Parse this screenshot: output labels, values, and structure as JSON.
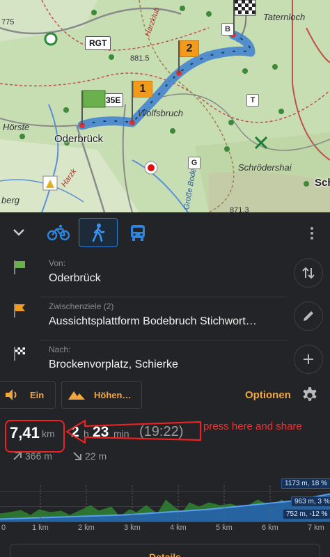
{
  "map": {
    "labels": {
      "town_oderbrueck": "Oderbrück",
      "place_wolfsbruch": "Wolfsbruch",
      "place_schroedershai": "Schrödershai",
      "place_taternloch": "Taternloch",
      "place_hoerste": "Hörste",
      "place_berg": "berg",
      "place_sch": "Sch",
      "road_harzklub": "Harzklub",
      "road_harzk": "Harzk",
      "road_grosse_bode": "Große Bode",
      "elev_881": "881.5",
      "elev_871": "871.3",
      "elev_775": "775"
    },
    "road_tags": {
      "rgt": "RGT",
      "b_mark": "B",
      "b35e": "35E",
      "g_mark": "G",
      "t_mark": "T"
    },
    "intermediate_flags": [
      "1",
      "2"
    ],
    "colors": {
      "route": "#3d7fd0",
      "background": "#c9dfb6",
      "flag_orange": "#f29a1c",
      "flag_green": "#6ab04c"
    }
  },
  "panel": {
    "modes": [
      {
        "name": "bicycle",
        "active": false
      },
      {
        "name": "pedestrian",
        "active": true
      },
      {
        "name": "bus",
        "active": false
      }
    ],
    "route": {
      "from_caption": "Von:",
      "from_value": "Oderbrück",
      "via_caption": "Zwischenziele (2)",
      "via_value": "Aussichtsplattform Bodebruch Stichwort…",
      "to_caption": "Nach:",
      "to_value": "Brockenvorplatz, Schierke"
    },
    "options": {
      "sound_label": "Ein",
      "elevation_label": "Höhen…",
      "options_label": "Optionen"
    },
    "stats": {
      "distance_value": "7,41",
      "distance_unit": "km",
      "hours_value": "2",
      "hours_unit": "h",
      "minutes_value": "23",
      "minutes_unit": "min",
      "arrival_time": "(19:22)",
      "ascent": "366 m",
      "descent": "22 m"
    },
    "annotation": {
      "text": "press here and share"
    },
    "chart": {
      "badges": [
        "1173 m, 18 %",
        "963 m, 3 %",
        "752 m, -12 %"
      ],
      "km_labels": [
        "0",
        "1 km",
        "2 km",
        "3 km",
        "4 km",
        "5 km",
        "6 km",
        "7 km"
      ]
    },
    "details_label": "Details"
  },
  "colors": {
    "accent": "#f2a640",
    "active_blue": "#2f7fd6",
    "annotation": "#e22222"
  }
}
